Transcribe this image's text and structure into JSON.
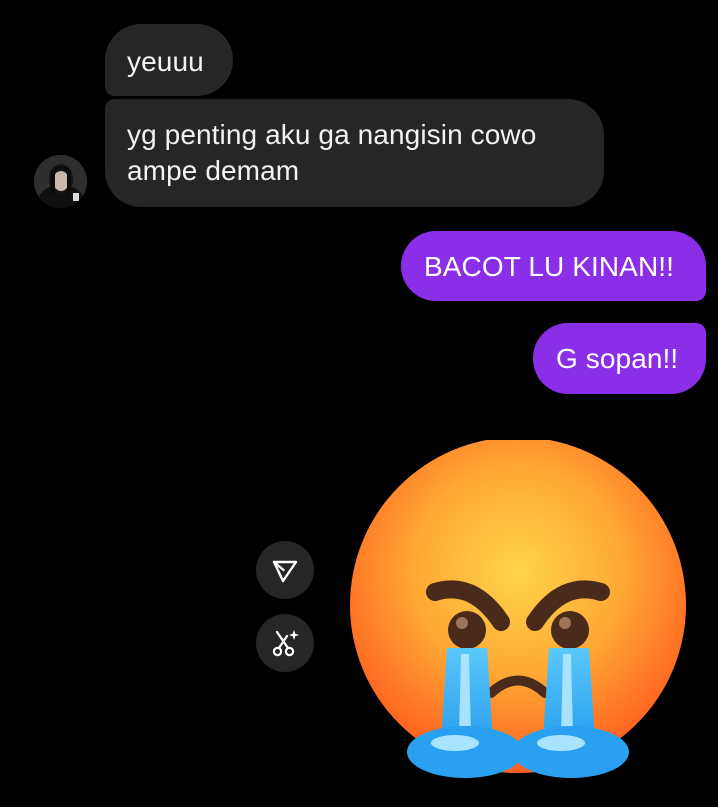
{
  "conversation": {
    "messages": [
      {
        "direction": "incoming",
        "text": "yeuuu"
      },
      {
        "direction": "incoming",
        "text": "yg penting aku ga nangisin cowo ampe demam"
      },
      {
        "direction": "outgoing",
        "text": "BACOT LU KINAN!!"
      },
      {
        "direction": "outgoing",
        "text": "G sopan!!"
      }
    ],
    "sticker": "crying-angry-face-emoji"
  },
  "actions": {
    "share_icon": "send-paper-plane-icon",
    "remix_icon": "scissors-sparkle-icon"
  },
  "theme": {
    "background": "#000000",
    "incoming_bubble": "#262626",
    "outgoing_bubble": "#8b2ee8",
    "text": "#f2f2f2"
  }
}
